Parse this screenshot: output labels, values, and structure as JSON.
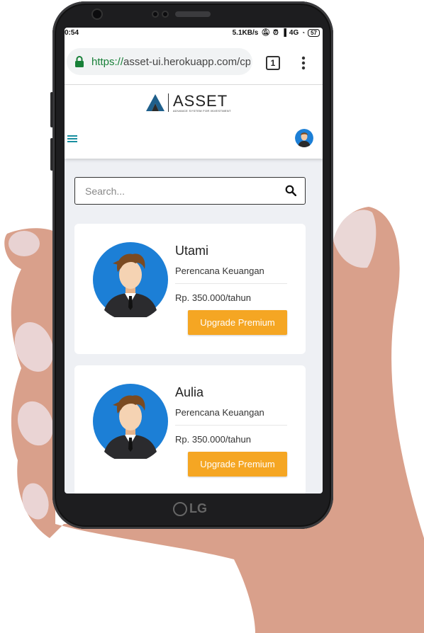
{
  "status_bar": {
    "time": "0:54",
    "speed": "5.1KB/s",
    "network": "4G",
    "battery": "57"
  },
  "browser": {
    "url_scheme": "https://",
    "url_rest": "asset-ui.herokuapp.com/cp",
    "tab_count": "1"
  },
  "app": {
    "logo_name": "ASSET",
    "logo_tagline": "ADVANCE SYSTEM FOR INVESTMENT"
  },
  "search": {
    "placeholder": "Search..."
  },
  "planners": [
    {
      "name": "Utami",
      "role": "Perencana Keuangan",
      "price": "Rp. 350.000/tahun",
      "button": "Upgrade Premium"
    },
    {
      "name": "Aulia",
      "role": "Perencana Keuangan",
      "price": "Rp. 350.000/tahun",
      "button": "Upgrade Premium"
    }
  ],
  "device": {
    "brand": "LG"
  },
  "colors": {
    "accent": "#f5a623",
    "avatar_bg": "#1c7fd6",
    "url_green": "#188038",
    "menu": "#1a8fa0"
  }
}
